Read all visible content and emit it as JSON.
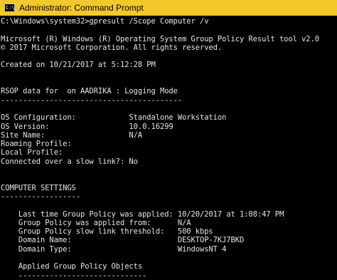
{
  "window": {
    "title": "Administrator: Command Prompt",
    "icon": "cmd-icon",
    "icon_text": "C:\\"
  },
  "console": {
    "lines": [
      "C:\\Windows\\system32>gpresult /Scope Computer /v",
      "",
      "Microsoft (R) Windows (R) Operating System Group Policy Result tool v2.0",
      "© 2017 Microsoft Corporation. All rights reserved.",
      "",
      "Created on ‎10/‎21/‎2017 at 5:12:28 PM",
      "",
      "",
      "RSOP data for  on AADRIKA : Logging Mode",
      "-----------------------------------------",
      "",
      "OS Configuration:            Standalone Workstation",
      "OS Version:                  10.0.16299",
      "Site Name:                   N/A",
      "Roaming Profile:",
      "Local Profile:",
      "Connected over a slow link?: No",
      "",
      "",
      "COMPUTER SETTINGS",
      "------------------",
      "",
      "    Last time Group Policy was applied: 10/20/2017 at 1:08:47 PM",
      "    Group Policy was applied from:      N/A",
      "    Group Policy slow link threshold:   500 kbps",
      "    Domain Name:                        DESKTOP-7KJ7BKD",
      "    Domain Type:                        WindowsNT 4",
      "",
      "    Applied Group Policy Objects",
      "    -----------------------------"
    ]
  }
}
